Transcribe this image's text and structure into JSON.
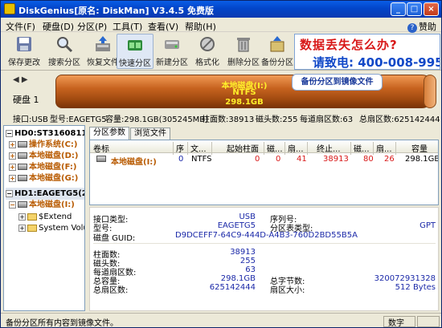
{
  "window": {
    "title": "DiskGenius[原名: DiskMan] V3.4.5 免费版"
  },
  "menu": [
    "文件(F)",
    "硬盘(D)",
    "分区(P)",
    "工具(T)",
    "查看(V)",
    "帮助(H)"
  ],
  "help_label": "赞助",
  "toolbar": [
    "保存更改",
    "搜索分区",
    "恢复文件",
    "快速分区",
    "新建分区",
    "格式化",
    "删除分区",
    "备份分区"
  ],
  "ad": {
    "line1": "数据丢失怎么办?",
    "line2": "请致电: 400-008-995"
  },
  "disk": {
    "label": "硬盘 1",
    "partition_name": "本地磁盘(I:)",
    "partition_fs": "NTFS",
    "partition_size": "298.1GB",
    "tooltip": "备份分区到镜像文件"
  },
  "infoline": {
    "iface": "接口:USB",
    "model": "型号:EAGETG5",
    "capacity": "容量:298.1GB(305245MB)",
    "cylinders": "柱面数:38913",
    "heads": "磁头数:255",
    "sectors": "每道扇区数:63",
    "total": "总扇区数:625142444"
  },
  "tree": [
    {
      "label": "HD0:ST3160811A",
      "indent": 0,
      "kind": "disk",
      "style": "bold"
    },
    {
      "label": "操作系统(C:)",
      "indent": 1,
      "kind": "part",
      "style": "orange"
    },
    {
      "label": "本地磁盘(D:)",
      "indent": 1,
      "kind": "part",
      "style": "orange"
    },
    {
      "label": "本地磁盘(F:)",
      "indent": 1,
      "kind": "part",
      "style": "orange"
    },
    {
      "label": "本地磁盘(G:)",
      "indent": 1,
      "kind": "part",
      "style": "orange"
    },
    {
      "label": "HD1:EAGETG5(298",
      "indent": 0,
      "kind": "disk",
      "style": "bold sel"
    },
    {
      "label": "本地磁盘(I:)",
      "indent": 1,
      "kind": "part",
      "style": "orange"
    },
    {
      "label": "$Extend",
      "indent": 2,
      "kind": "folder",
      "style": ""
    },
    {
      "label": "System Volu",
      "indent": 2,
      "kind": "folder",
      "style": ""
    }
  ],
  "tabs": [
    "分区参数",
    "浏览文件"
  ],
  "grid": {
    "headers": [
      "卷标",
      "序",
      "文...",
      "起始柱面",
      "磁...",
      "扇...",
      "终止...",
      "磁...",
      "扇...",
      "容量"
    ],
    "row": [
      "本地磁盘(I:)",
      "0",
      "NTFS",
      "0",
      "0",
      "41",
      "38913",
      "80",
      "26",
      "298.1GB"
    ]
  },
  "details": {
    "iface_label": "接口类型:",
    "iface_value": "USB",
    "serial_label": "序列号:",
    "serial_value": "",
    "model_label": "型号:",
    "model_value": "EAGETG5",
    "pt_label": "分区表类型:",
    "pt_value": "GPT",
    "guid_label": "磁盘 GUID:",
    "guid_value": "D9DCEFF7-64C9-444D-A4B3-760D2BD55B5A",
    "cyl_label": "柱面数:",
    "cyl_value": "38913",
    "heads_label": "磁头数:",
    "heads_value": "255",
    "spt_label": "每道扇区数:",
    "spt_value": "63",
    "cap_label": "总容量:",
    "cap_value": "298.1GB",
    "bytes_label": "总字节数:",
    "bytes_value": "320072931328",
    "sectors_label": "总扇区数:",
    "sectors_value": "625142444",
    "ss_label": "扇区大小:",
    "ss_value": "512 Bytes"
  },
  "status": {
    "text": "备份分区所有内容到镜像文件。",
    "mode": "数字"
  }
}
